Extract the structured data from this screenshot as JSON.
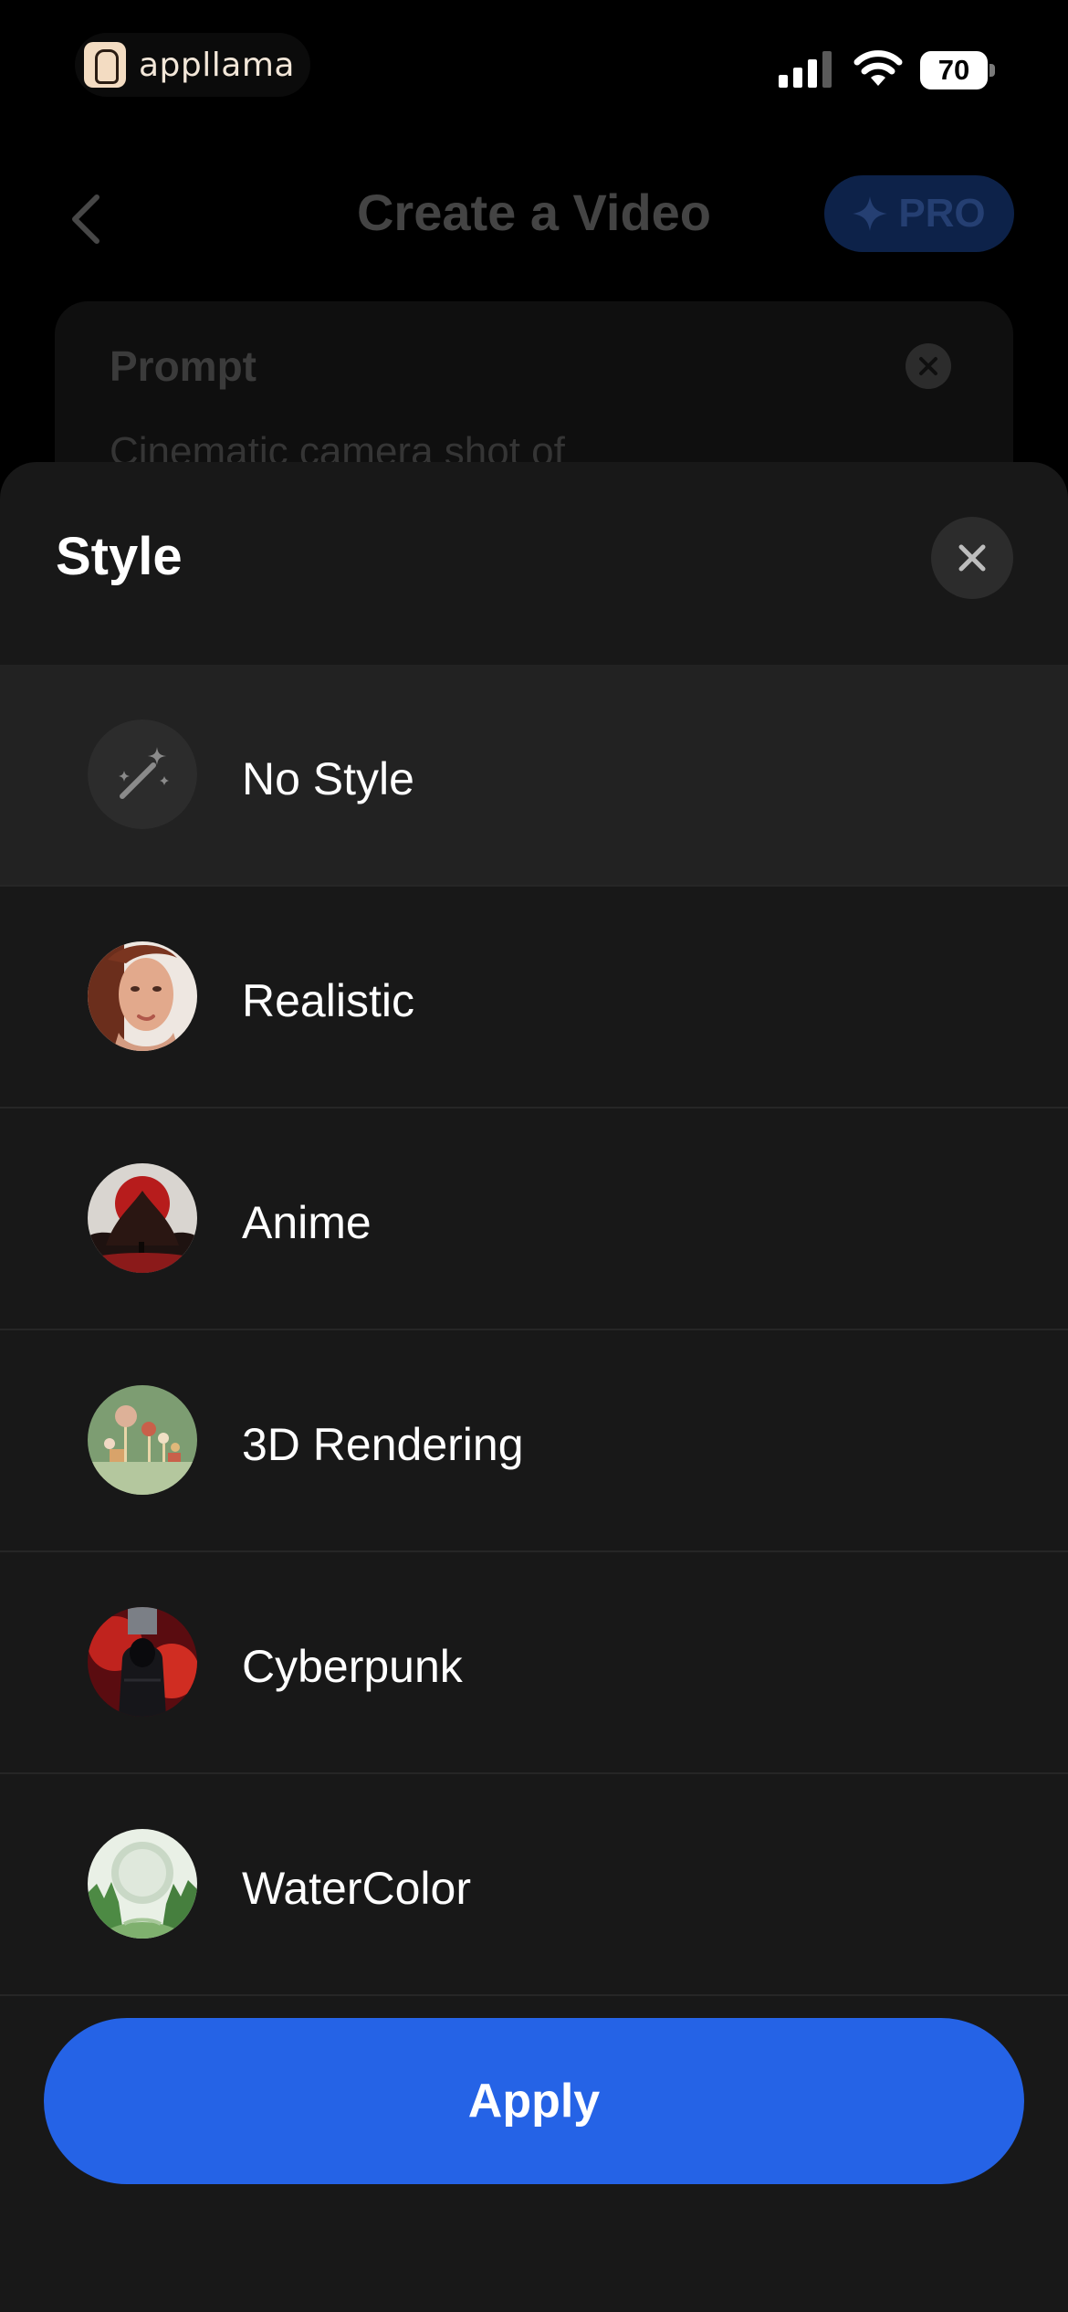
{
  "status_bar": {
    "brand_name": "appllama",
    "battery_level": "70",
    "icons": [
      "signal-icon",
      "wifi-icon",
      "battery-icon"
    ]
  },
  "background_page": {
    "title": "Create a Video",
    "pro_label": "PRO",
    "prompt_label": "Prompt",
    "prompt_text": "Cinematic camera shot of",
    "icons": [
      "back-chevron-icon",
      "sparkle-icon",
      "clear-icon"
    ]
  },
  "sheet": {
    "title": "Style",
    "close_icon": "close-icon",
    "styles": [
      {
        "label": "No Style",
        "thumbnail": "magic-wand-icon",
        "selected": true
      },
      {
        "label": "Realistic",
        "thumbnail": "portrait-thumbnail",
        "selected": false
      },
      {
        "label": "Anime",
        "thumbnail": "anime-thumbnail",
        "selected": false
      },
      {
        "label": "3D Rendering",
        "thumbnail": "3d-rendering-thumbnail",
        "selected": false
      },
      {
        "label": "Cyberpunk",
        "thumbnail": "cyberpunk-thumbnail",
        "selected": false
      },
      {
        "label": "WaterColor",
        "thumbnail": "watercolor-thumbnail",
        "selected": false
      }
    ],
    "apply_label": "Apply"
  },
  "colors": {
    "accent": "#2563e6",
    "sheet_background": "#181818",
    "selected_row": "#222222",
    "pro_badge": "#0d2249"
  }
}
